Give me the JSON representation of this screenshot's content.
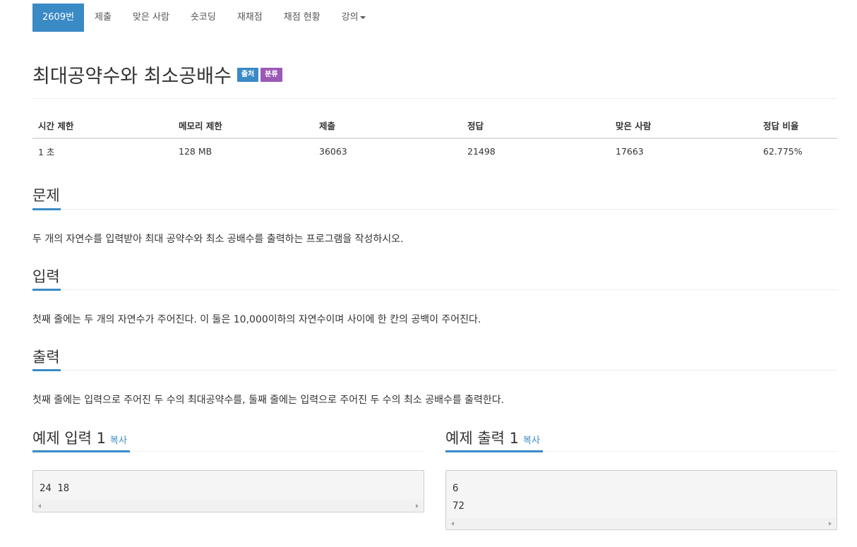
{
  "nav": {
    "items": [
      {
        "label": "2609번"
      },
      {
        "label": "제출"
      },
      {
        "label": "맞은 사람"
      },
      {
        "label": "숏코딩"
      },
      {
        "label": "재채점"
      },
      {
        "label": "채점 현황"
      },
      {
        "label": "강의"
      }
    ]
  },
  "problem": {
    "title": "최대공약수와 최소공배수",
    "labels": [
      {
        "text": "출처",
        "color": "#3a8ac6"
      },
      {
        "text": "분류",
        "color": "#9b59b6"
      }
    ]
  },
  "info_table": {
    "headers": [
      "시간 제한",
      "메모리 제한",
      "제출",
      "정답",
      "맞은 사람",
      "정답 비율"
    ],
    "values": [
      "1 초",
      "128 MB",
      "36063",
      "21498",
      "17663",
      "62.775%"
    ]
  },
  "sections": {
    "problem": {
      "heading": "문제",
      "text": "두 개의 자연수를 입력받아 최대 공약수와 최소 공배수를 출력하는 프로그램을 작성하시오."
    },
    "input": {
      "heading": "입력",
      "text": "첫째 줄에는 두 개의 자연수가 주어진다. 이 둘은 10,000이하의 자연수이며 사이에 한 칸의 공백이 주어진다."
    },
    "output": {
      "heading": "출력",
      "text": "첫째 줄에는 입력으로 주어진 두 수의 최대공약수를, 둘째 줄에는 입력으로 주어진 두 수의 최소 공배수를 출력한다."
    }
  },
  "samples": {
    "input": {
      "heading": "예제 입력 1",
      "copy": "복사",
      "content": "24 18"
    },
    "output": {
      "heading": "예제 출력 1",
      "copy": "복사",
      "content": "6\n72"
    }
  },
  "colors": {
    "accent": "#3a8ac6",
    "label_source": "#3a8ac6",
    "label_category": "#9b59b6"
  }
}
